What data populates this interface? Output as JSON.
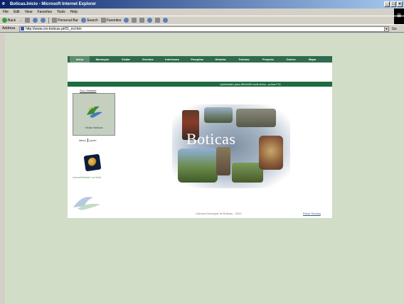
{
  "window": {
    "title": "Boticas.Inicio - Microsoft Internet Explorer",
    "controls": [
      "_",
      "□",
      "×"
    ]
  },
  "menu": [
    "File",
    "Edit",
    "View",
    "Favorites",
    "Tools",
    "Help"
  ],
  "toolbar": {
    "back": "Back",
    "forward": "→",
    "personal_bar": "Personal Bar",
    "search": "Search",
    "favorites": "Favorites"
  },
  "address": {
    "label": "Address",
    "url": "http://www.cm-boticas.pt/01_ini.htm",
    "go": "Go"
  },
  "site": {
    "nav": [
      "Inicio",
      "Municipio",
      "Visitar",
      "Eventos",
      "Interesses",
      "Pesquisa",
      "História",
      "Turismo",
      "Projecto",
      "Outros",
      "Mapa"
    ],
    "active_nav": "Inicio",
    "banner": "optimizado para 800x600 ecrã cheio - prima F11",
    "sou_visitante": "Sou Visitante",
    "visitar_label": "Visitar Boticas",
    "lang_pt": "latina",
    "lang_en": "ponte",
    "acessibilidade": "Acessibilidade na Web",
    "collage_title": "Boticas",
    "footer_camara": "Câmara Municipal de Boticas - 2003",
    "ficha": "Ficha Técnica"
  },
  "colors": {
    "nav_green": "#2f6b4c",
    "page_bg": "#d1ddc7",
    "banner_green": "#1f6b40"
  }
}
